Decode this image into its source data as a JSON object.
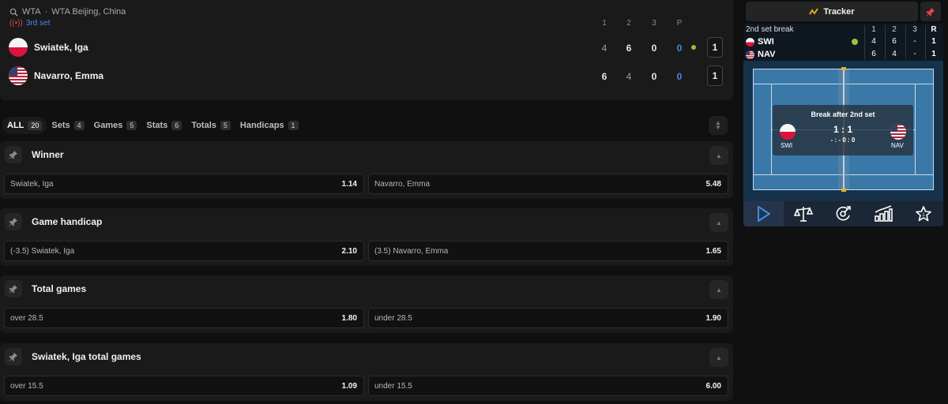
{
  "scoreboard": {
    "tour": "WTA",
    "separator": "·",
    "tournament": "WTA Beijing, China",
    "status": "3rd set",
    "columns": [
      "1",
      "2",
      "3",
      "P"
    ],
    "players": [
      {
        "name": "Swiatek, Iga",
        "flag": "poland",
        "sets": [
          "4",
          "6",
          "0"
        ],
        "points": "0",
        "sets_won": "1",
        "serving": true
      },
      {
        "name": "Navarro, Emma",
        "flag": "usa",
        "sets": [
          "6",
          "4",
          "0"
        ],
        "points": "0",
        "sets_won": "1",
        "serving": false
      }
    ]
  },
  "tabs": [
    {
      "label": "ALL",
      "count": "20",
      "active": true
    },
    {
      "label": "Sets",
      "count": "4"
    },
    {
      "label": "Games",
      "count": "5"
    },
    {
      "label": "Stats",
      "count": "6"
    },
    {
      "label": "Totals",
      "count": "5"
    },
    {
      "label": "Handicaps",
      "count": "1"
    }
  ],
  "markets": [
    {
      "title": "Winner",
      "outcomes": [
        {
          "label": "Swiatek, Iga",
          "odds": "1.14"
        },
        {
          "label": "Navarro, Emma",
          "odds": "5.48"
        }
      ]
    },
    {
      "title": "Game handicap",
      "outcomes": [
        {
          "label": "(-3.5) Swiatek, Iga",
          "odds": "2.10"
        },
        {
          "label": "(3.5) Navarro, Emma",
          "odds": "1.65"
        }
      ]
    },
    {
      "title": "Total games",
      "outcomes": [
        {
          "label": "over 28.5",
          "odds": "1.80"
        },
        {
          "label": "under 28.5",
          "odds": "1.90"
        }
      ]
    },
    {
      "title": "Swiatek, Iga total games",
      "outcomes": [
        {
          "label": "over 15.5",
          "odds": "1.09"
        },
        {
          "label": "under 15.5",
          "odds": "6.00"
        }
      ]
    }
  ],
  "tracker": {
    "button_label": "Tracker",
    "status": "2nd set break",
    "columns": [
      "1",
      "2",
      "3",
      "R"
    ],
    "rows": [
      {
        "abbr": "SWI",
        "flag": "poland",
        "values": [
          "4",
          "6",
          "-",
          "1"
        ],
        "serving": true
      },
      {
        "abbr": "NAV",
        "flag": "usa",
        "values": [
          "6",
          "4",
          "-",
          "1"
        ],
        "serving": false
      }
    ],
    "overlay": {
      "title": "Break after 2nd set",
      "score": "1 : 1",
      "sub": "- : -   0 : 0",
      "left": "SWI",
      "right": "NAV"
    },
    "nav_icons": [
      "play-icon",
      "scales-icon",
      "pitch-icon",
      "stats-icon",
      "star-icon"
    ]
  },
  "colors": {
    "background": "#101010",
    "panel": "#1a1a1a",
    "accent_blue": "#4a86e8",
    "live_red": "#e04848",
    "serve_green": "#8fc43a",
    "court": "#3a78a8",
    "tracker_gold": "#f0b020"
  }
}
